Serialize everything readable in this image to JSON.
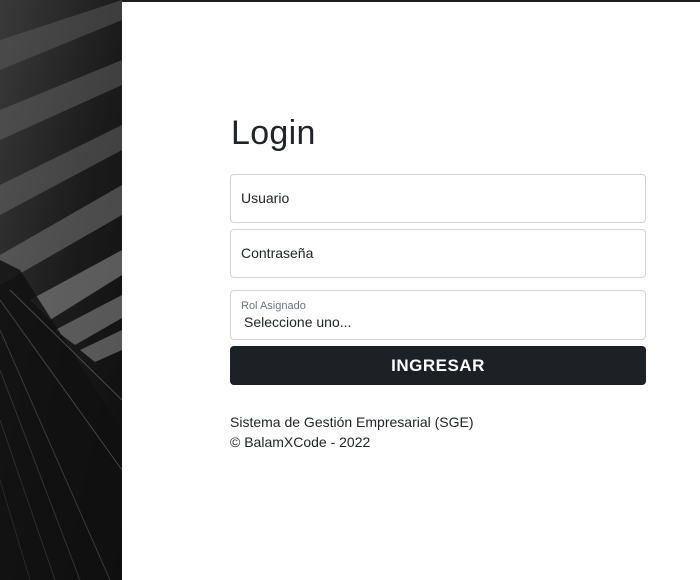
{
  "login": {
    "title": "Login",
    "username_placeholder": "Usuario",
    "password_placeholder": "Contraseña",
    "role_label": "Rol Asignado",
    "role_selected": "Seleccione uno...",
    "submit_label": "INGRESAR"
  },
  "footer": {
    "system_name": "Sistema de Gestión Empresarial (SGE)",
    "copyright": "© BalamXCode - 2022"
  }
}
